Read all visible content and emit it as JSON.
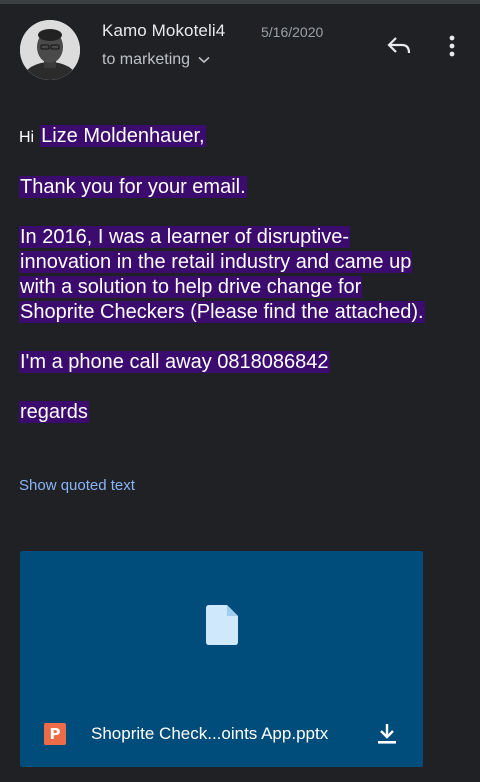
{
  "header": {
    "sender_name": "Kamo Mokoteli4",
    "date": "5/16/2020",
    "recipient": "to marketing",
    "reply_icon": "reply-icon",
    "more_icon": "more-vert-icon",
    "chevron_icon": "chevron-down-icon"
  },
  "message": {
    "greeting_hi": "Hi",
    "greeting_name": "Lize Moldenhauer,",
    "line1": "Thank you for your email.",
    "para2_l1": "In 2016, I was a learner of disruptive-",
    "para2_l2": "innovation in the retail industry and came up",
    "para2_l3": "with a solution to help drive change for",
    "para2_l4": "Shoprite Checkers (Please find the attached).",
    "phone_line": "I'm a phone call away 0818086842",
    "signoff": "regards"
  },
  "show_quoted_label": "Show quoted text",
  "attachment": {
    "badge": "P",
    "filename": "Shoprite Check...oints App.pptx",
    "icon": "file-icon",
    "download_icon": "download-icon"
  },
  "colors": {
    "background": "#202124",
    "highlight": "#3b0c6e",
    "link": "#8ab4f8",
    "attachment_bg": "#004c7a",
    "ppt_badge": "#ed6c47"
  }
}
